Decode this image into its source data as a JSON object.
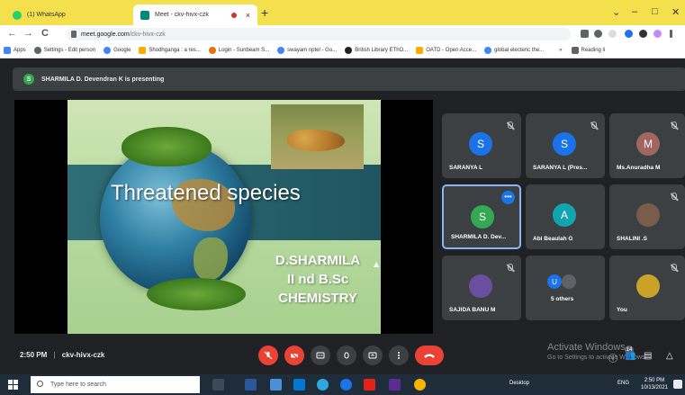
{
  "browser": {
    "tabs": [
      {
        "title": "(1) WhatsApp",
        "close": "×"
      },
      {
        "title": "Meet - ckv-hivx-czk",
        "close": "×"
      }
    ],
    "new_tab_glyph": "+",
    "window_controls": {
      "collapse": "⌄",
      "minimize": "–",
      "restore": "□",
      "close": "✕"
    },
    "nav": {
      "back": "←",
      "forward": "→",
      "reload": "C"
    },
    "url_host": "meet.google.com",
    "url_path": "/ckv-hivx-czk",
    "bookmarks": [
      {
        "label": "Apps",
        "color": "#4285f4"
      },
      {
        "label": "Settings - Edit person",
        "color": "#5f6368"
      },
      {
        "label": "Google",
        "color": "#4285f4"
      },
      {
        "label": "Shodhganga : a res...",
        "color": "#f9ab00"
      },
      {
        "label": "Login - Sunbeam S...",
        "color": "#e8710a"
      },
      {
        "label": "swayam nptel - Go...",
        "color": "#4285f4"
      },
      {
        "label": "British Library EThO...",
        "color": "#202124"
      },
      {
        "label": "OATD - Open Acce...",
        "color": "#f9ab00"
      },
      {
        "label": "global electeric the...",
        "color": "#4285f4"
      }
    ],
    "bookmarks_more": "»",
    "reading_list": "Reading li"
  },
  "meet": {
    "presenter_initial": "S",
    "presenter_banner": "SHARMILA D. Devendran K is presenting",
    "slide": {
      "title": "Threatened species",
      "author_lines": [
        "D.SHARMILA",
        "II nd B.Sc",
        "CHEMISTRY"
      ]
    },
    "participants": [
      {
        "initial": "S",
        "name": "SARANYA L",
        "color": "#1a73e8"
      },
      {
        "initial": "S",
        "name": "SARANYA L (Pres...",
        "color": "#1a73e8"
      },
      {
        "initial": "M",
        "name": "Ms.Anuradha M",
        "color": "#a1665e"
      },
      {
        "initial": "S",
        "name": "SHARMILA D. Dev...",
        "color": "#34a853"
      },
      {
        "initial": "A",
        "name": "Abi Beaulah G",
        "color": "#12a4af"
      },
      {
        "initial": "",
        "name": "SHALINI .S",
        "color": "#7a5c4a"
      },
      {
        "initial": "",
        "name": "SAJIDA BANU M",
        "color": "#6a4fa0"
      },
      {
        "initial": "U",
        "name": "5 others",
        "color": "#1a73e8"
      },
      {
        "initial": "",
        "name": "You",
        "color": "#c9a227"
      }
    ],
    "time": "2:50 PM",
    "separator": "|",
    "meeting_code": "ckv-hivx-czk",
    "activate_title": "Activate Windows",
    "activate_sub": "Go to Settings to activate Windows.",
    "people_count": "14"
  },
  "taskbar": {
    "search_placeholder": "Type here to search",
    "desktop_label": "Desktop",
    "language": "ENG",
    "clock_time": "2:50 PM",
    "clock_date": "10/13/2021"
  },
  "colors": {
    "tab_bar": "#f4e04d",
    "meet_bg": "#202124",
    "end_call": "#ea4335",
    "taskbar": "#1f2d3a"
  }
}
